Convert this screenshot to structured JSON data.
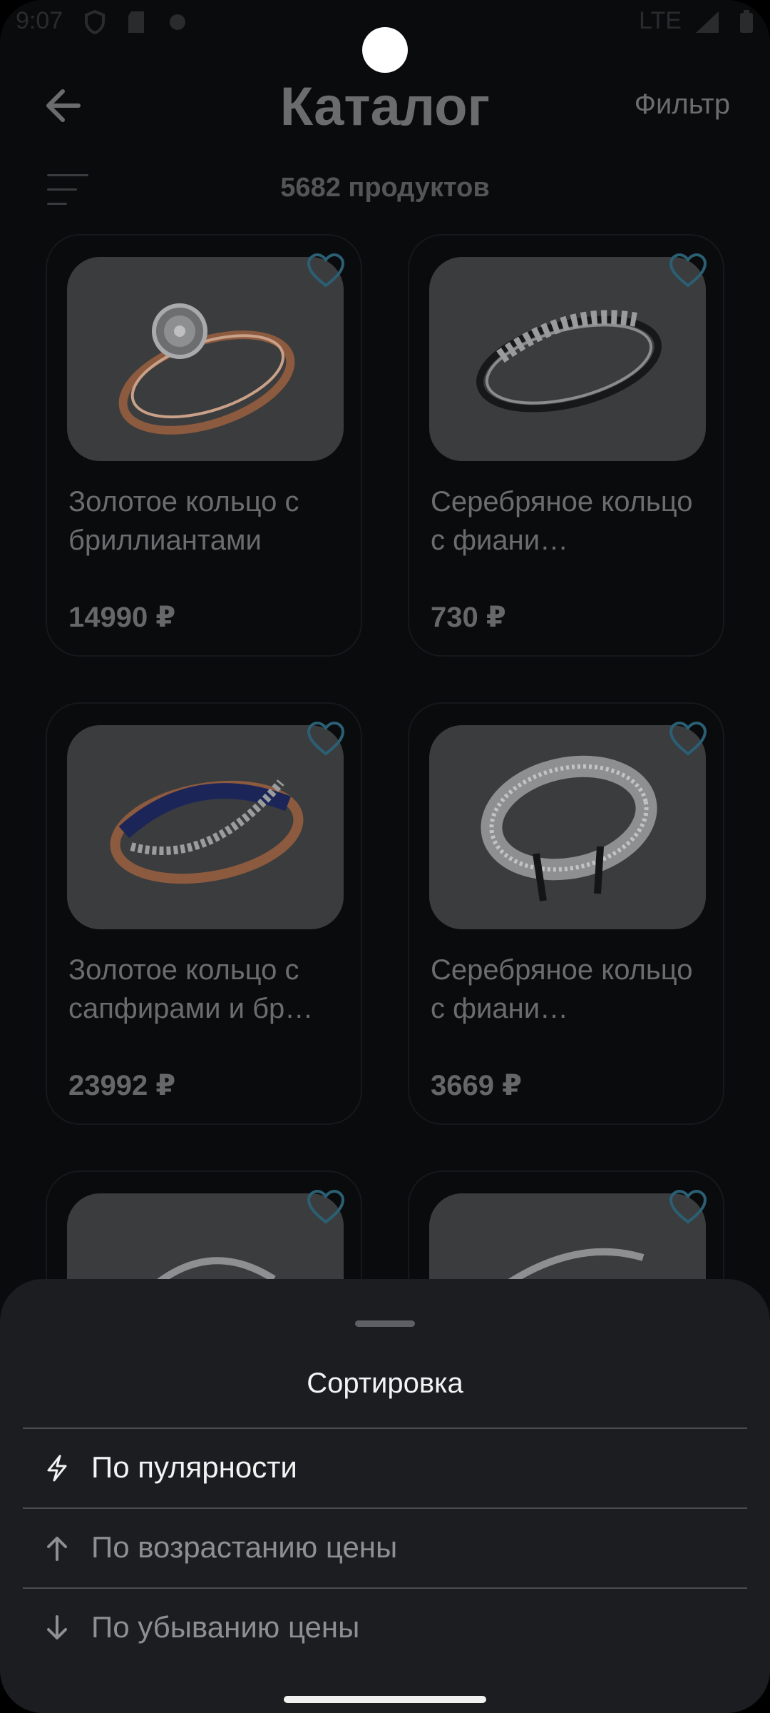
{
  "status_bar": {
    "time": "9:07",
    "network": "LTE"
  },
  "header": {
    "title": "Каталог",
    "filter_label": "Фильтр",
    "product_count": "5682 продуктов"
  },
  "products": [
    {
      "name": "Золотое кольцо с бриллиантами",
      "price": "14990 ₽",
      "image": "gold-ring-diamonds"
    },
    {
      "name": "Серебряное кольцо с фиани…",
      "price": "730 ₽",
      "image": "silver-ring-cubic-zirconia"
    },
    {
      "name": "Золотое кольцо с сапфирами и бр…",
      "price": "23992 ₽",
      "image": "gold-ring-sapphires"
    },
    {
      "name": "Серебряное кольцо с фиани…",
      "price": "3669 ₽",
      "image": "silver-ring-wide"
    },
    {
      "name": "",
      "price": "",
      "image": "silver-ring"
    },
    {
      "name": "",
      "price": "",
      "image": "silver-ring"
    }
  ],
  "sort_sheet": {
    "title": "Сортировка",
    "options": [
      {
        "label": "По пулярности",
        "icon": "lightning-icon",
        "active": true
      },
      {
        "label": "По возрастанию цены",
        "icon": "arrow-up-icon",
        "active": false
      },
      {
        "label": "По убыванию цены",
        "icon": "arrow-down-icon",
        "active": false
      }
    ]
  },
  "colors": {
    "background": "#0a0b0d",
    "sheet": "#1b1d21",
    "accent_heart": "#2b5f73"
  }
}
